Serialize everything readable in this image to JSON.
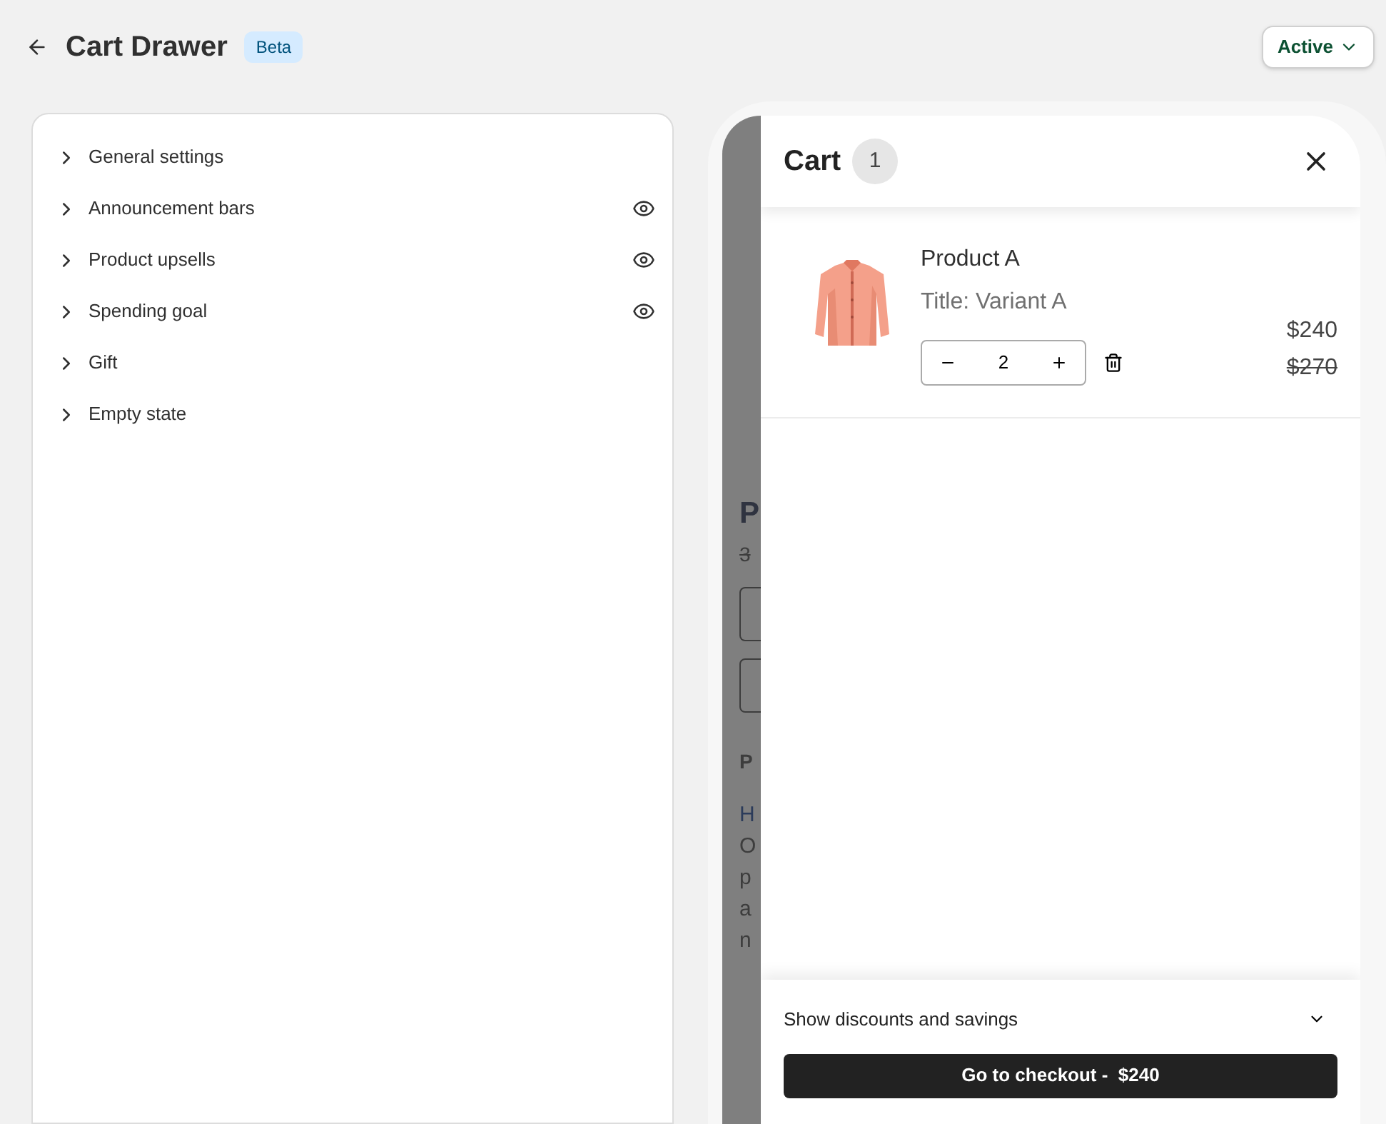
{
  "header": {
    "title": "Cart Drawer",
    "badge": "Beta",
    "status": "Active"
  },
  "sections": [
    {
      "label": "General settings",
      "visible_icon": false
    },
    {
      "label": "Announcement bars",
      "visible_icon": true
    },
    {
      "label": "Product upsells",
      "visible_icon": true
    },
    {
      "label": "Spending goal",
      "visible_icon": true
    },
    {
      "label": "Gift",
      "visible_icon": false
    },
    {
      "label": "Empty state",
      "visible_icon": false
    }
  ],
  "store_page": {
    "heading": "P",
    "price": "3",
    "subheading": "P",
    "lines": [
      {
        "text": "H",
        "kind": "link"
      },
      {
        "text": "O",
        "kind": "text"
      },
      {
        "text": "p",
        "kind": "text"
      },
      {
        "text": "a",
        "kind": "text"
      },
      {
        "text": "n",
        "kind": "text"
      }
    ]
  },
  "cart": {
    "title": "Cart",
    "count": "1",
    "items": [
      {
        "name": "Product A",
        "variant": "Title: Variant A",
        "quantity": "2",
        "price": "$240",
        "compare_price": "$270"
      }
    ],
    "discounts_label": "Show discounts and savings",
    "checkout": "Go to checkout -  $240"
  }
}
